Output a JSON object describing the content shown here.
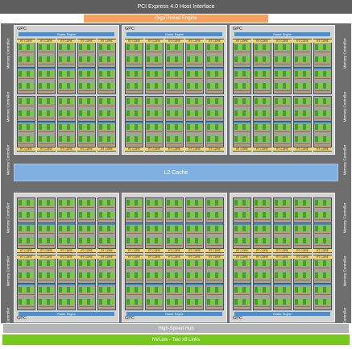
{
  "header": {
    "pcie": "PCI Express 4.0 Host Interface",
    "gigathread": "GigaThread Engine"
  },
  "memory_controller_label": "Memory Controller",
  "gpc_label": "GPC",
  "raster_engine_label": "Raster Engine",
  "rt_core_label": "RT CORE",
  "l2_cache": "L2 Cache",
  "high_speed_hub": "High-Speed Hub",
  "nvlink": "NVLink - Two x8 Links",
  "colors": {
    "pcie": "#5e5e5e",
    "gigathread": "#f3a35f",
    "frame": "#6e6e6e",
    "gpc_bg": "#d2d3d3",
    "raster": "#4a8fd2",
    "sm_core": "#3fa31b",
    "sm_core_alt": "#74d034",
    "rt_core": "#ffd75a",
    "l2": "#7fb0e1",
    "hub": "#b4b5b6",
    "nvlink": "#76c81e"
  },
  "layout": {
    "gpc_count": 6,
    "tpcs_per_gpc": 6,
    "sms_per_tpc": 2,
    "memory_controllers": 12
  }
}
